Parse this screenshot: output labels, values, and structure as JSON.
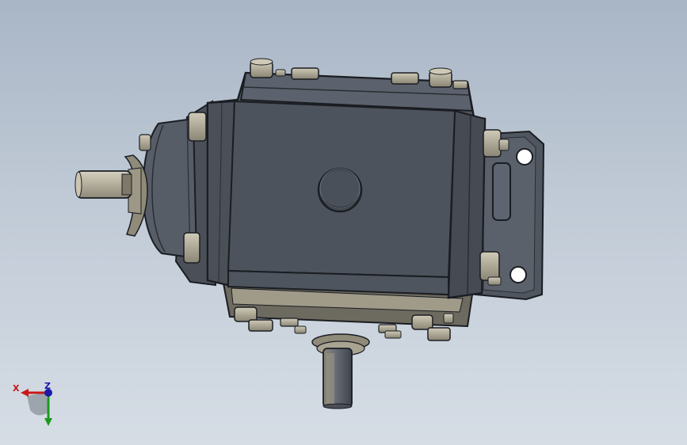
{
  "viewport": {
    "background_top": "#a9b6c6",
    "background_bottom": "#d6dde5"
  },
  "model": {
    "body_color": "#4f5561",
    "edge_color": "#1a1d22",
    "fastener_color": "#9b9683",
    "shaft_color": "#b8b2a0"
  },
  "triad": {
    "x_label": "X",
    "z_label": "Z",
    "x_color": "#c81818",
    "y_color": "#1a9a1a",
    "z_color": "#1a1aa8"
  }
}
